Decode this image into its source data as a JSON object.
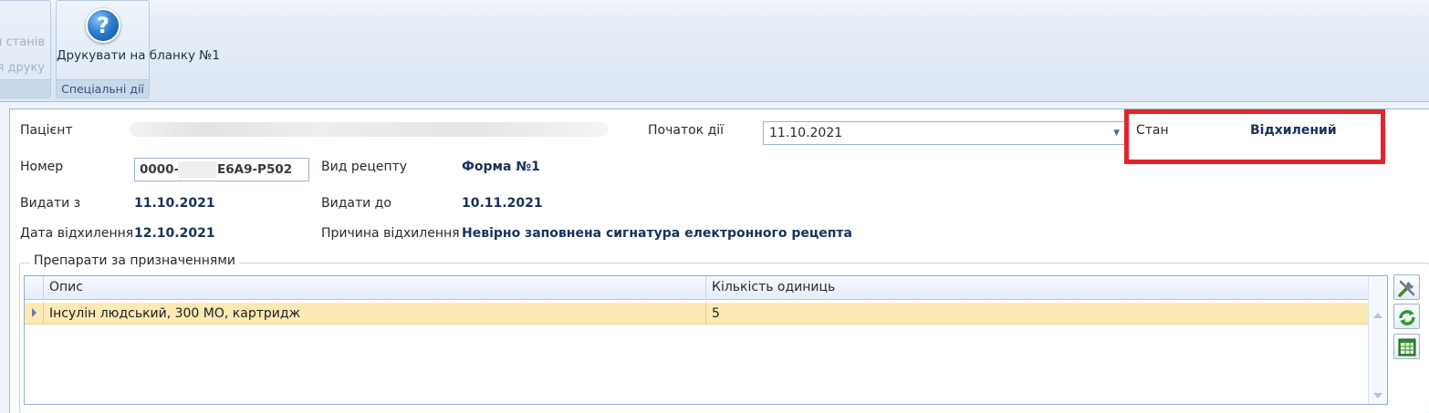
{
  "ribbon": {
    "left_group": {
      "line1": "я станів",
      "line2": "я друку"
    },
    "special_group": {
      "button_label": "Друкувати на бланку №1",
      "caption": "Спеціальні дії"
    }
  },
  "form": {
    "patient_label": "Пацієнт",
    "start_label": "Початок дії",
    "start_value": "11.10.2021",
    "state_label": "Стан",
    "state_value": "Відхилений",
    "number_label": "Номер",
    "number_prefix": "0000-",
    "number_suffix": "E6A9-P502",
    "recipe_type_label": "Вид рецепту",
    "recipe_type_value": "Форма №1",
    "issue_from_label": "Видати з",
    "issue_from_value": "11.10.2021",
    "issue_to_label": "Видати до",
    "issue_to_value": "10.11.2021",
    "reject_date_label": "Дата відхилення",
    "reject_date_value": "12.10.2021",
    "reject_reason_label": "Причина відхилення",
    "reject_reason_value": "Невірно заповнена сигнатура електронного рецепта"
  },
  "drugs": {
    "title": "Препарати за призначеннями",
    "columns": [
      "Опис",
      "Кількість одиниць"
    ],
    "rows": [
      {
        "description": "Інсулін людський, 300 МО, картридж",
        "quantity": "5"
      }
    ]
  },
  "colors": {
    "highlight": "#e3242b",
    "value_text": "#16325c",
    "selected_row": "#fde9b4"
  }
}
